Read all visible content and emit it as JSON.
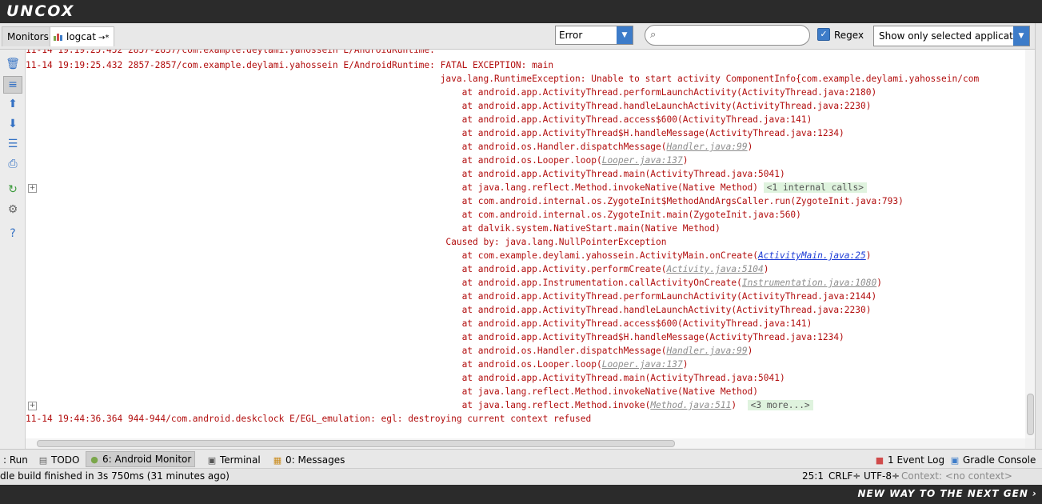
{
  "brand": {
    "logo": "UNCOX",
    "tagline": "NEW WAY TO THE NEXT GEN ›"
  },
  "tabs": {
    "monitors": "Monitors",
    "logcat": "logcat",
    "pin": "→*"
  },
  "filters": {
    "level": "Error",
    "search_placeholder": "",
    "regex_label": "Regex",
    "regex_checked": true,
    "app_filter": "Show only selected application"
  },
  "log": {
    "lines": [
      {
        "text": "11-14 19:19:25.432 2857-2857/com.example.deylami.yahossein E/AndroidRuntime: FATAL EXCEPTION: main"
      },
      {
        "text": "                                                                             java.lang.RuntimeException: Unable to start activity ComponentInfo{com.example.deylami.yahossein/com"
      },
      {
        "text": "                                                                                 at android.app.ActivityThread.performLaunchActivity(ActivityThread.java:2180)"
      },
      {
        "text": "                                                                                 at android.app.ActivityThread.handleLaunchActivity(ActivityThread.java:2230)"
      },
      {
        "text": "                                                                                 at android.app.ActivityThread.access$600(ActivityThread.java:141)"
      },
      {
        "text": "                                                                                 at android.app.ActivityThread$H.handleMessage(ActivityThread.java:1234)"
      },
      {
        "text": "                                                                                 at android.os.Handler.dispatchMessage(",
        "link": "Handler.java:99",
        "tail": ")"
      },
      {
        "text": "                                                                                 at android.os.Looper.loop(",
        "link": "Looper.java:137",
        "tail": ")"
      },
      {
        "text": "                                                                                 at android.app.ActivityThread.main(ActivityThread.java:5041)"
      },
      {
        "text": "                                                                                 at java.lang.reflect.Method.invokeNative(Native Method) ",
        "fold": "<1 internal calls>"
      },
      {
        "text": "                                                                                 at com.android.internal.os.ZygoteInit$MethodAndArgsCaller.run(ZygoteInit.java:793)"
      },
      {
        "text": "                                                                                 at com.android.internal.os.ZygoteInit.main(ZygoteInit.java:560)"
      },
      {
        "text": "                                                                                 at dalvik.system.NativeStart.main(Native Method)"
      },
      {
        "text": "                                                                              Caused by: java.lang.NullPointerException"
      },
      {
        "text": "                                                                                 at com.example.deylami.yahossein.ActivityMain.onCreate(",
        "link_blue": "ActivityMain.java:25",
        "tail": ")"
      },
      {
        "text": "                                                                                 at android.app.Activity.performCreate(",
        "link": "Activity.java:5104",
        "tail": ")"
      },
      {
        "text": "                                                                                 at android.app.Instrumentation.callActivityOnCreate(",
        "link": "Instrumentation.java:1080",
        "tail": ")"
      },
      {
        "text": "                                                                                 at android.app.ActivityThread.performLaunchActivity(ActivityThread.java:2144)"
      },
      {
        "text": "                                                                                 at android.app.ActivityThread.handleLaunchActivity(ActivityThread.java:2230)"
      },
      {
        "text": "                                                                                 at android.app.ActivityThread.access$600(ActivityThread.java:141)"
      },
      {
        "text": "                                                                                 at android.app.ActivityThread$H.handleMessage(ActivityThread.java:1234)"
      },
      {
        "text": "                                                                                 at android.os.Handler.dispatchMessage(",
        "link": "Handler.java:99",
        "tail": ")"
      },
      {
        "text": "                                                                                 at android.os.Looper.loop(",
        "link": "Looper.java:137",
        "tail": ")"
      },
      {
        "text": "                                                                                 at android.app.ActivityThread.main(ActivityThread.java:5041)"
      },
      {
        "text": "                                                                                 at java.lang.reflect.Method.invokeNative(Native Method)"
      },
      {
        "text": "                                                                                 at java.lang.reflect.Method.invoke(",
        "link": "Method.java:511",
        "tail": ")  ",
        "fold": "<3 more...>"
      },
      {
        "text": "11-14 19:44:36.364 944-944/com.android.deskclock E/EGL_emulation: egl: destroying current context refused"
      }
    ]
  },
  "bottom_tools": [
    {
      "label": ": Run",
      "icon": "run-icon"
    },
    {
      "label": "TODO",
      "icon": "todo-icon"
    },
    {
      "label": "6: Android Monitor",
      "icon": "android-icon"
    },
    {
      "label": "Terminal",
      "icon": "terminal-icon"
    },
    {
      "label": "0: Messages",
      "icon": "messages-icon"
    },
    {
      "label": "1 Event Log",
      "icon": "event-log-icon"
    },
    {
      "label": "Gradle Console",
      "icon": "gradle-console-icon"
    }
  ],
  "status": {
    "message": "dle build finished in 3s 750ms (31 minutes ago)",
    "position": "25:1",
    "line_sep": "CRLF÷",
    "encoding": "UTF-8÷",
    "context": "Context: <no context>"
  },
  "colors": {
    "error_text": "#b20e0e",
    "accent": "#3d7cc9"
  }
}
